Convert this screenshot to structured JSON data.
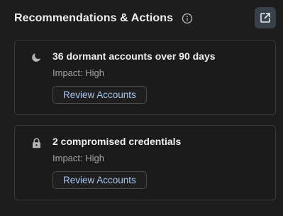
{
  "header": {
    "title": "Recommendations & Actions",
    "info_icon": "info-circle-icon",
    "external_icon": "open-external-icon"
  },
  "colors": {
    "background": "#1d1d1e",
    "card_border": "#3b3b3d",
    "button_text": "#a9c7ee",
    "muted_text": "#a3a3a3",
    "icon_button_bg": "#38404a"
  },
  "recommendations": [
    {
      "icon": "moon-icon",
      "title": "36 dormant accounts over 90 days",
      "impact": "Impact: High",
      "action_label": "Review Accounts"
    },
    {
      "icon": "lock-icon",
      "title": "2 compromised credentials",
      "impact": "Impact: High",
      "action_label": "Review Accounts"
    }
  ]
}
